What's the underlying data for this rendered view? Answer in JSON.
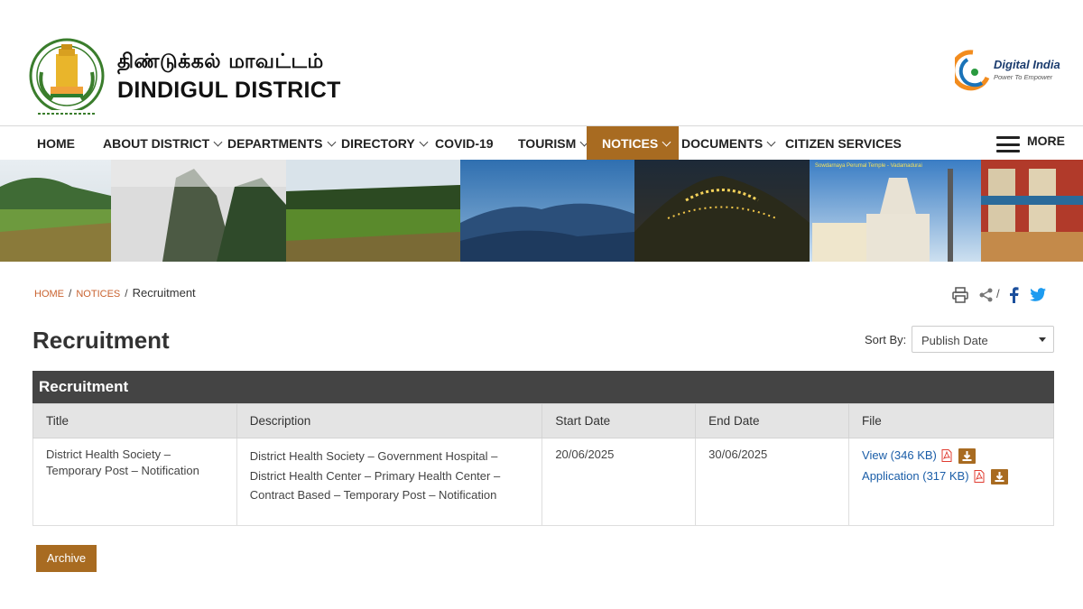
{
  "header": {
    "title_tamil": "திண்டுக்கல் மாவட்டம்",
    "title_english": "DINDIGUL DISTRICT",
    "digital_india": "Digital India",
    "digital_india_tagline": "Power To Empower"
  },
  "nav": {
    "items": [
      {
        "label": "HOME",
        "has_dropdown": false
      },
      {
        "label": "ABOUT DISTRICT",
        "has_dropdown": true
      },
      {
        "label": "DEPARTMENTS",
        "has_dropdown": true
      },
      {
        "label": "DIRECTORY",
        "has_dropdown": true
      },
      {
        "label": "COVID-19",
        "has_dropdown": false
      },
      {
        "label": "TOURISM",
        "has_dropdown": true
      },
      {
        "label": "NOTICES",
        "has_dropdown": true,
        "active": true
      },
      {
        "label": "DOCUMENTS",
        "has_dropdown": true
      },
      {
        "label": "CITIZEN SERVICES",
        "has_dropdown": false
      }
    ],
    "more_label": "MORE"
  },
  "banner": {
    "caption": "Sowdarnaya Perumal Temple - Vadamadurai"
  },
  "breadcrumb": {
    "items": [
      "HOME",
      "NOTICES"
    ],
    "current": "Recruitment"
  },
  "page": {
    "title": "Recruitment",
    "sort_label": "Sort By:",
    "sort_value": "Publish Date"
  },
  "table": {
    "caption": "Recruitment",
    "headers": [
      "Title",
      "Description",
      "Start Date",
      "End Date",
      "File"
    ],
    "rows": [
      {
        "title": "District Health Society – Temporary Post – Notification",
        "description": "District Health Society – Government Hospital – District Health Center – Primary Health Center – Contract Based – Temporary Post – Notification",
        "start_date": "20/06/2025",
        "end_date": "30/06/2025",
        "files": [
          {
            "label": "View (346 KB)"
          },
          {
            "label": "Application (317 KB)"
          }
        ]
      }
    ]
  },
  "archive_label": "Archive",
  "colors": {
    "accent": "#a86b21",
    "table_caption_bg": "#444444",
    "link": "#1b5ea8",
    "breadcrumb_link": "#c9622f"
  }
}
